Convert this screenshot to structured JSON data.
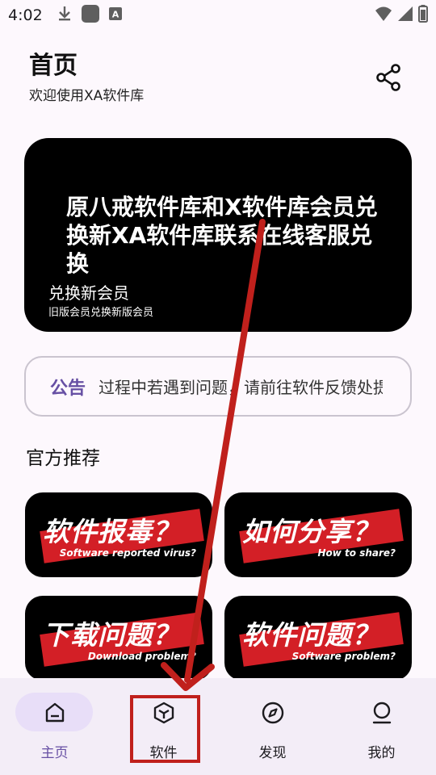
{
  "status_bar": {
    "time": "4:02",
    "left_icons": [
      "download-icon",
      "app-square-icon",
      "a-badge-icon"
    ],
    "right_icons": [
      "wifi-icon",
      "signal-icon",
      "battery-icon"
    ]
  },
  "header": {
    "title": "首页",
    "subtitle": "欢迎使用XA软件库",
    "share_icon": "share-icon"
  },
  "banner": {
    "text": "原八戒软件库和X软件库会员兑换新XA软件库联系在线客服兑换",
    "title": "兑换新会员",
    "subtitle": "旧版会员兑换新版会员"
  },
  "notice": {
    "label": "公告",
    "text": "过程中若遇到问题，请前往软件反馈处提"
  },
  "recommend": {
    "title": "官方推荐",
    "cards": [
      {
        "main": "软件报毒？",
        "eng": "Software reported virus?"
      },
      {
        "main": "如何分享？",
        "eng": "How to share?"
      },
      {
        "main": "下载问题？",
        "eng": "Download problem?"
      },
      {
        "main": "软件问题？",
        "eng": "Software problem?"
      }
    ]
  },
  "nav": {
    "items": [
      {
        "label": "主页",
        "icon": "home-icon",
        "active": true
      },
      {
        "label": "软件",
        "icon": "cube-icon",
        "active": false
      },
      {
        "label": "发现",
        "icon": "compass-icon",
        "active": false
      },
      {
        "label": "我的",
        "icon": "profile-icon",
        "active": false
      }
    ]
  },
  "colors": {
    "accent": "#6750a4",
    "background": "#fdf8fd",
    "nav_bg": "#f3edf7",
    "nav_pill": "#e8def8",
    "annotation": "#c0201c",
    "card_red": "#d31f26"
  }
}
